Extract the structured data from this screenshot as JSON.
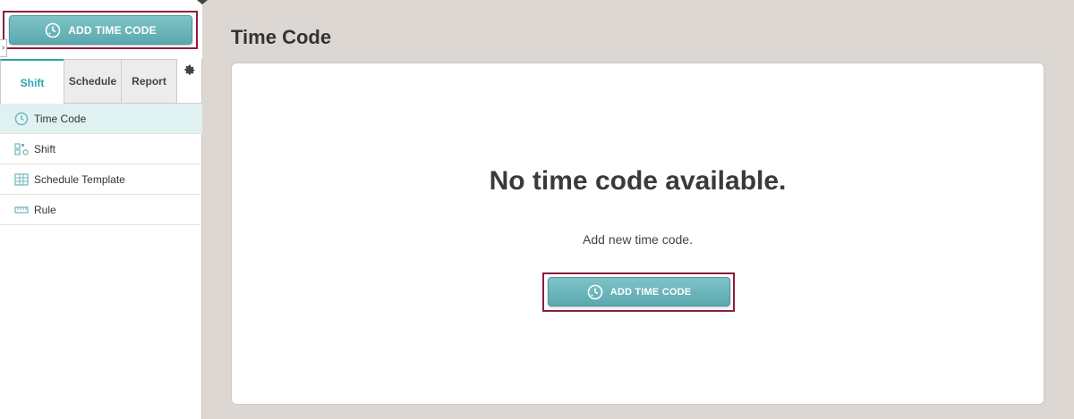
{
  "sidebar": {
    "add_button_label": "ADD TIME CODE",
    "tabs": [
      {
        "label": "Shift"
      },
      {
        "label": "Schedule"
      },
      {
        "label": "Report"
      }
    ],
    "menu": [
      {
        "label": "Time Code",
        "icon": "clock-icon"
      },
      {
        "label": "Shift",
        "icon": "shift-icon"
      },
      {
        "label": "Schedule Template",
        "icon": "schedule-template-icon"
      },
      {
        "label": "Rule",
        "icon": "ruler-icon"
      }
    ],
    "collapse_glyph": "›"
  },
  "main": {
    "title": "Time Code",
    "empty_title": "No time code available.",
    "empty_subtitle": "Add new time code.",
    "add_button_label": "ADD TIME CODE"
  },
  "colors": {
    "accent": "#2aa5a8",
    "button": "#6bb7bc",
    "highlight_frame": "#8a1e3e",
    "background": "#dcd7d3"
  }
}
